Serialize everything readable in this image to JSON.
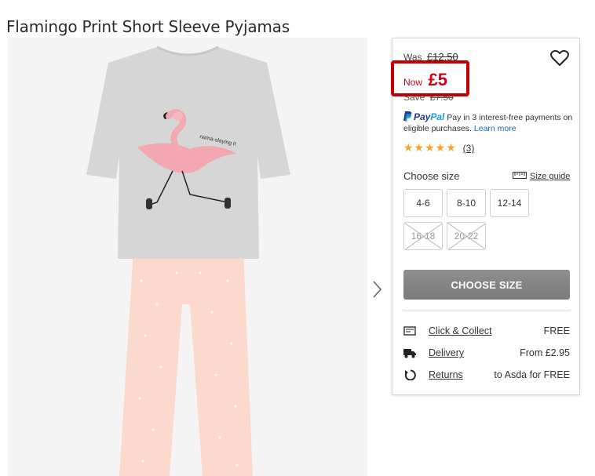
{
  "product": {
    "title": "Flamingo Print Short Sleeve Pyjamas",
    "image_alt": "flamingo-pyjamas-image",
    "shirt_text": "nama-slaying it"
  },
  "price": {
    "was_label": "Was",
    "was_value": "£12.50",
    "now_label": "Now",
    "now_value": "£5",
    "save_label": "Save",
    "save_value": "£7.50",
    "highlight_color": "#c00000",
    "price_color": "#d0021b"
  },
  "paypal": {
    "logo_pay": "Pay",
    "logo_pal": "Pal",
    "text": "Pay in 3 interest-free payments on eligible purchases.",
    "learn_more": "Learn more"
  },
  "rating": {
    "stars": "★★★★★",
    "value": 5,
    "reviews_count": "(3)"
  },
  "sizes": {
    "label": "Choose size",
    "guide_label": "Size guide",
    "options": [
      {
        "label": "4-6",
        "available": true
      },
      {
        "label": "8-10",
        "available": true
      },
      {
        "label": "12-14",
        "available": true
      },
      {
        "label": "16-18",
        "available": false
      },
      {
        "label": "20-22",
        "available": false
      }
    ]
  },
  "cta": {
    "choose_size_button": "CHOOSE SIZE"
  },
  "fulfilment": [
    {
      "icon": "store-icon",
      "label": "Click & Collect",
      "value": "FREE"
    },
    {
      "icon": "delivery-truck-icon",
      "label": "Delivery",
      "value": "From £2.95"
    },
    {
      "icon": "returns-icon",
      "label": "Returns",
      "value": "to Asda for FREE"
    }
  ],
  "icons": {
    "wishlist": "heart-icon",
    "next": "chevron-right-icon",
    "size_guide": "ruler-icon"
  }
}
